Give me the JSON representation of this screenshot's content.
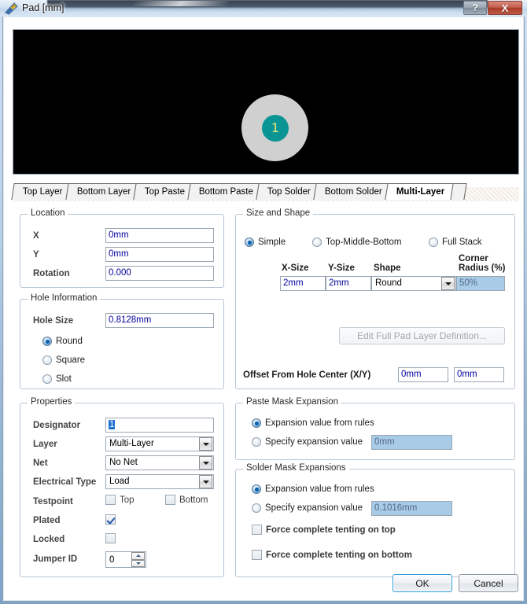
{
  "window": {
    "title": "Pad [mm]",
    "icon": "pad-ruler-icon",
    "help_label": "?",
    "close_label": "X"
  },
  "preview": {
    "designator": "1",
    "pad_color": "#d0d0d0",
    "hole_color": "#0b9494",
    "designator_color": "#e8e87a",
    "background": "#000000"
  },
  "tabs": [
    {
      "label": "Top Layer",
      "active": false
    },
    {
      "label": "Bottom Layer",
      "active": false
    },
    {
      "label": "Top Paste",
      "active": false
    },
    {
      "label": "Bottom Paste",
      "active": false
    },
    {
      "label": "Top Solder",
      "active": false
    },
    {
      "label": "Bottom Solder",
      "active": false
    },
    {
      "label": "Multi-Layer",
      "active": true
    }
  ],
  "location": {
    "legend": "Location",
    "x_label": "X",
    "x_value": "0mm",
    "y_label": "Y",
    "y_value": "0mm",
    "rotation_label": "Rotation",
    "rotation_value": "0.000"
  },
  "hole_information": {
    "legend": "Hole Information",
    "hole_size_label": "Hole Size",
    "hole_size_value": "0.8128mm",
    "shapes": [
      {
        "label": "Round",
        "selected": true
      },
      {
        "label": "Square",
        "selected": false
      },
      {
        "label": "Slot",
        "selected": false
      }
    ]
  },
  "properties": {
    "legend": "Properties",
    "designator_label": "Designator",
    "designator_value": "1",
    "layer_label": "Layer",
    "layer_value": "Multi-Layer",
    "net_label": "Net",
    "net_value": "No Net",
    "electrical_type_label": "Electrical Type",
    "electrical_type_value": "Load",
    "testpoint_label": "Testpoint",
    "testpoint_top_label": "Top",
    "testpoint_top_checked": false,
    "testpoint_bottom_label": "Bottom",
    "testpoint_bottom_checked": false,
    "plated_label": "Plated",
    "plated_checked": true,
    "locked_label": "Locked",
    "locked_checked": false,
    "jumper_id_label": "Jumper ID",
    "jumper_id_value": "0"
  },
  "size_and_shape": {
    "legend": "Size and Shape",
    "modes": [
      {
        "label": "Simple",
        "selected": true
      },
      {
        "label": "Top-Middle-Bottom",
        "selected": false
      },
      {
        "label": "Full Stack",
        "selected": false
      }
    ],
    "col_x_size": "X-Size",
    "col_y_size": "Y-Size",
    "col_shape": "Shape",
    "col_corner_radius_line1": "Corner",
    "col_corner_radius_line2": "Radius (%)",
    "x_size_value": "2mm",
    "y_size_value": "2mm",
    "shape_value": "Round",
    "corner_radius_value": "50%",
    "edit_full_pad_label": "Edit Full Pad Layer Definition...",
    "offset_label": "Offset From Hole Center (X/Y)",
    "offset_x_value": "0mm",
    "offset_y_value": "0mm"
  },
  "paste_mask_expansion": {
    "legend": "Paste Mask Expansion",
    "from_rules_label": "Expansion value from rules",
    "from_rules_selected": true,
    "specify_label": "Specify expansion value",
    "specify_selected": false,
    "specify_value": "0mm"
  },
  "solder_mask_expansions": {
    "legend": "Solder Mask Expansions",
    "from_rules_label": "Expansion value from rules",
    "from_rules_selected": true,
    "specify_label": "Specify expansion value",
    "specify_selected": false,
    "specify_value": "0.1016mm",
    "tent_top_label": "Force complete tenting on top",
    "tent_top_checked": false,
    "tent_bottom_label": "Force complete tenting on bottom",
    "tent_bottom_checked": false
  },
  "footer": {
    "ok_label": "OK",
    "cancel_label": "Cancel"
  }
}
